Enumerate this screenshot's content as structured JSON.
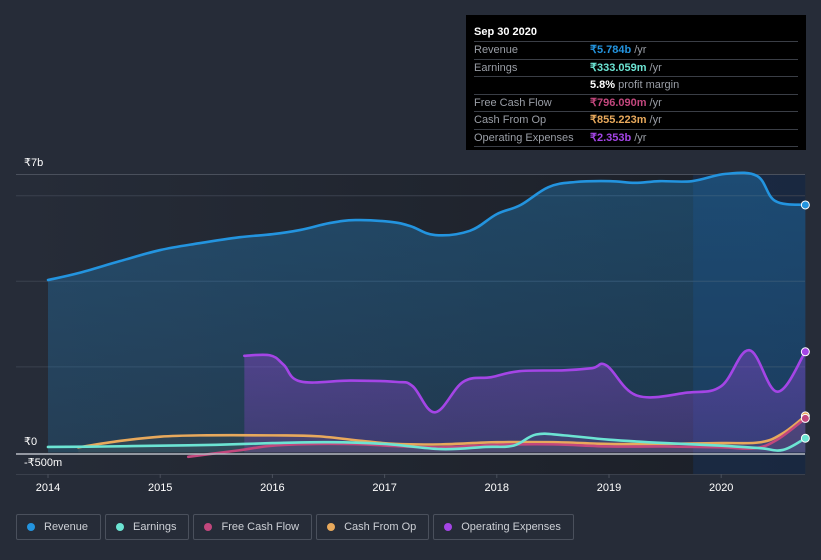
{
  "tooltip": {
    "date": "Sep 30 2020",
    "rows": [
      {
        "label": "Revenue",
        "value": "₹5.784b",
        "unit": "/yr",
        "color": "#2394df"
      },
      {
        "label": "Earnings",
        "value": "₹333.059m",
        "unit": "/yr",
        "color": "#6ce4d3"
      },
      {
        "label": "",
        "value": "5.8%",
        "unit": "profit margin",
        "color": "#ffffff"
      },
      {
        "label": "Free Cash Flow",
        "value": "₹796.090m",
        "unit": "/yr",
        "color": "#c2477d"
      },
      {
        "label": "Cash From Op",
        "value": "₹855.223m",
        "unit": "/yr",
        "color": "#e8a95c"
      },
      {
        "label": "Operating Expenses",
        "value": "₹2.353b",
        "unit": "/yr",
        "color": "#a445e6"
      }
    ]
  },
  "legend": [
    {
      "label": "Revenue",
      "color": "#2394df"
    },
    {
      "label": "Earnings",
      "color": "#6ce4d3"
    },
    {
      "label": "Free Cash Flow",
      "color": "#c2477d"
    },
    {
      "label": "Cash From Op",
      "color": "#e8a95c"
    },
    {
      "label": "Operating Expenses",
      "color": "#a445e6"
    }
  ],
  "chart_data": {
    "type": "area",
    "title": "",
    "xlabel": "",
    "ylabel": "",
    "currency": "₹",
    "units": "billions",
    "xlim": [
      2014.0,
      2020.75
    ],
    "ylim": [
      -0.5,
      7.0
    ],
    "y_tick_labels": [
      {
        "label": "₹7b",
        "value": 7.0
      },
      {
        "label": "₹0",
        "value": 0
      },
      {
        "label": "-₹500m",
        "value": -0.5
      }
    ],
    "gridlines": [
      2,
      4,
      6
    ],
    "x_tick_labels": [
      "2014",
      "2015",
      "2016",
      "2017",
      "2018",
      "2019",
      "2020"
    ],
    "x_ticks": [
      2014,
      2015,
      2016,
      2017,
      2018,
      2019,
      2020
    ],
    "highlight_range": [
      2019.75,
      2020.75
    ],
    "grid": true,
    "legend_position": "bottom-left",
    "series": [
      {
        "name": "Revenue",
        "color": "#2394df",
        "fill": true,
        "x": [
          2014.0,
          2014.27,
          2014.64,
          2015.0,
          2015.35,
          2015.71,
          2016.0,
          2016.25,
          2016.51,
          2016.74,
          2017.05,
          2017.23,
          2017.45,
          2017.76,
          2018.0,
          2018.21,
          2018.46,
          2018.7,
          2019.01,
          2019.23,
          2019.45,
          2019.74,
          2020.04,
          2020.32,
          2020.48,
          2020.75
        ],
        "y": [
          4.03,
          4.19,
          4.47,
          4.73,
          4.89,
          5.03,
          5.1,
          5.2,
          5.36,
          5.43,
          5.39,
          5.29,
          5.08,
          5.18,
          5.57,
          5.78,
          6.2,
          6.32,
          6.34,
          6.3,
          6.34,
          6.34,
          6.51,
          6.46,
          5.88,
          5.784
        ]
      },
      {
        "name": "Operating Expenses",
        "color": "#a445e6",
        "fill": true,
        "x": [
          2015.75,
          2015.98,
          2016.1,
          2016.25,
          2016.7,
          2017.1,
          2017.25,
          2017.45,
          2017.7,
          2017.95,
          2018.2,
          2018.6,
          2018.85,
          2018.98,
          2019.25,
          2019.7,
          2020.0,
          2020.25,
          2020.5,
          2020.75
        ],
        "y": [
          2.26,
          2.27,
          2.05,
          1.66,
          1.68,
          1.65,
          1.55,
          0.94,
          1.65,
          1.76,
          1.9,
          1.92,
          1.97,
          2.03,
          1.33,
          1.4,
          1.55,
          2.39,
          1.42,
          2.353
        ]
      },
      {
        "name": "Cash From Op",
        "color": "#e8a95c",
        "fill": false,
        "x": [
          2014.27,
          2014.64,
          2015.0,
          2015.35,
          2016.0,
          2016.4,
          2016.8,
          2017.1,
          2017.5,
          2018.0,
          2018.5,
          2019.0,
          2019.5,
          2020.0,
          2020.35,
          2020.55,
          2020.75
        ],
        "y": [
          0.12,
          0.27,
          0.37,
          0.4,
          0.4,
          0.38,
          0.27,
          0.2,
          0.19,
          0.24,
          0.24,
          0.2,
          0.2,
          0.22,
          0.24,
          0.45,
          0.855
        ]
      },
      {
        "name": "Free Cash Flow",
        "color": "#c2477d",
        "fill": false,
        "x": [
          2015.25,
          2015.7,
          2016.0,
          2016.4,
          2016.8,
          2017.1,
          2017.5,
          2018.0,
          2018.5,
          2019.0,
          2019.5,
          2020.0,
          2020.3,
          2020.5,
          2020.75
        ],
        "y": [
          -0.1,
          0.05,
          0.16,
          0.2,
          0.19,
          0.15,
          0.12,
          0.18,
          0.19,
          0.14,
          0.14,
          0.12,
          0.1,
          0.3,
          0.796
        ]
      },
      {
        "name": "Earnings",
        "color": "#6ce4d3",
        "fill": false,
        "x": [
          2014.0,
          2014.5,
          2015.0,
          2015.5,
          2016.0,
          2016.5,
          2017.0,
          2017.5,
          2017.9,
          2018.15,
          2018.35,
          2018.6,
          2019.0,
          2019.5,
          2020.0,
          2020.35,
          2020.55,
          2020.75
        ],
        "y": [
          0.13,
          0.14,
          0.16,
          0.18,
          0.22,
          0.24,
          0.2,
          0.08,
          0.13,
          0.16,
          0.42,
          0.4,
          0.3,
          0.22,
          0.16,
          0.1,
          0.06,
          0.333
        ]
      }
    ]
  }
}
